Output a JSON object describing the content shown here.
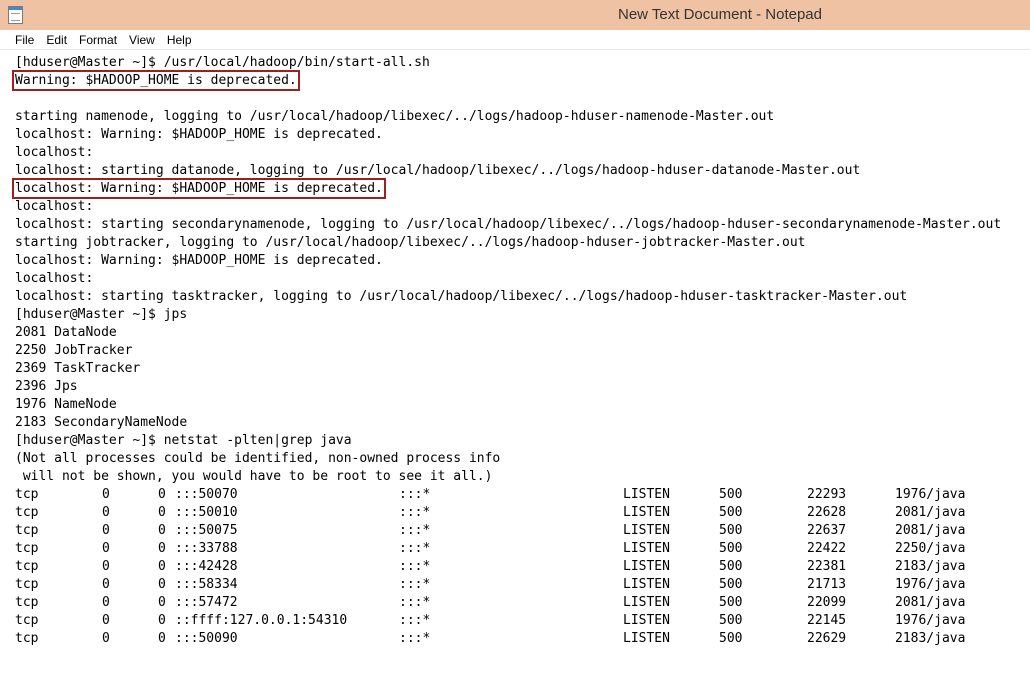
{
  "window": {
    "title": "New Text Document - Notepad",
    "icon": "notepad-icon"
  },
  "menu": [
    "File",
    "Edit",
    "Format",
    "View",
    "Help"
  ],
  "lines": [
    {
      "text": "[hduser@Master ~]$ /usr/local/hadoop/bin/start-all.sh",
      "highlight": false
    },
    {
      "text": "Warning: $HADOOP_HOME is deprecated.",
      "highlight": true
    },
    {
      "text": "",
      "highlight": false
    },
    {
      "text": "starting namenode, logging to /usr/local/hadoop/libexec/../logs/hadoop-hduser-namenode-Master.out",
      "highlight": false
    },
    {
      "text": "localhost: Warning: $HADOOP_HOME is deprecated.",
      "highlight": false
    },
    {
      "text": "localhost:",
      "highlight": false
    },
    {
      "text": "localhost: starting datanode, logging to /usr/local/hadoop/libexec/../logs/hadoop-hduser-datanode-Master.out",
      "highlight": false
    },
    {
      "text": "localhost: Warning: $HADOOP_HOME is deprecated.",
      "highlight": true
    },
    {
      "text": "localhost:",
      "highlight": false
    },
    {
      "text": "localhost: starting secondarynamenode, logging to /usr/local/hadoop/libexec/../logs/hadoop-hduser-secondarynamenode-Master.out",
      "highlight": false
    },
    {
      "text": "starting jobtracker, logging to /usr/local/hadoop/libexec/../logs/hadoop-hduser-jobtracker-Master.out",
      "highlight": false
    },
    {
      "text": "localhost: Warning: $HADOOP_HOME is deprecated.",
      "highlight": false
    },
    {
      "text": "localhost:",
      "highlight": false
    },
    {
      "text": "localhost: starting tasktracker, logging to /usr/local/hadoop/libexec/../logs/hadoop-hduser-tasktracker-Master.out",
      "highlight": false
    },
    {
      "text": "[hduser@Master ~]$ jps",
      "highlight": false
    },
    {
      "text": "2081 DataNode",
      "highlight": false
    },
    {
      "text": "2250 JobTracker",
      "highlight": false
    },
    {
      "text": "2369 TaskTracker",
      "highlight": false
    },
    {
      "text": "2396 Jps",
      "highlight": false
    },
    {
      "text": "1976 NameNode",
      "highlight": false
    },
    {
      "text": "2183 SecondaryNameNode",
      "highlight": false
    },
    {
      "text": "[hduser@Master ~]$ netstat -plten|grep java",
      "highlight": false
    },
    {
      "text": "(Not all processes could be identified, non-owned process info",
      "highlight": false
    },
    {
      "text": " will not be shown, you would have to be root to see it all.)",
      "highlight": false
    }
  ],
  "netstat": [
    {
      "proto": "tcp",
      "recvq": "0",
      "sendq": "0",
      "local": ":::50070",
      "foreign": ":::*",
      "state": "LISTEN",
      "user": "500",
      "inode": "22293",
      "program": "1976/java"
    },
    {
      "proto": "tcp",
      "recvq": "0",
      "sendq": "0",
      "local": ":::50010",
      "foreign": ":::*",
      "state": "LISTEN",
      "user": "500",
      "inode": "22628",
      "program": "2081/java"
    },
    {
      "proto": "tcp",
      "recvq": "0",
      "sendq": "0",
      "local": ":::50075",
      "foreign": ":::*",
      "state": "LISTEN",
      "user": "500",
      "inode": "22637",
      "program": "2081/java"
    },
    {
      "proto": "tcp",
      "recvq": "0",
      "sendq": "0",
      "local": ":::33788",
      "foreign": ":::*",
      "state": "LISTEN",
      "user": "500",
      "inode": "22422",
      "program": "2250/java"
    },
    {
      "proto": "tcp",
      "recvq": "0",
      "sendq": "0",
      "local": ":::42428",
      "foreign": ":::*",
      "state": "LISTEN",
      "user": "500",
      "inode": "22381",
      "program": "2183/java"
    },
    {
      "proto": "tcp",
      "recvq": "0",
      "sendq": "0",
      "local": ":::58334",
      "foreign": ":::*",
      "state": "LISTEN",
      "user": "500",
      "inode": "21713",
      "program": "1976/java"
    },
    {
      "proto": "tcp",
      "recvq": "0",
      "sendq": "0",
      "local": ":::57472",
      "foreign": ":::*",
      "state": "LISTEN",
      "user": "500",
      "inode": "22099",
      "program": "2081/java"
    },
    {
      "proto": "tcp",
      "recvq": "0",
      "sendq": "0",
      "local": "::ffff:127.0.0.1:54310",
      "foreign": ":::*",
      "state": "LISTEN",
      "user": "500",
      "inode": "22145",
      "program": "1976/java"
    },
    {
      "proto": "tcp",
      "recvq": "0",
      "sendq": "0",
      "local": ":::50090",
      "foreign": ":::*",
      "state": "LISTEN",
      "user": "500",
      "inode": "22629",
      "program": "2183/java"
    }
  ],
  "colors": {
    "titlebar": "#f0c2a4",
    "highlight_border": "#9e1f1f"
  }
}
